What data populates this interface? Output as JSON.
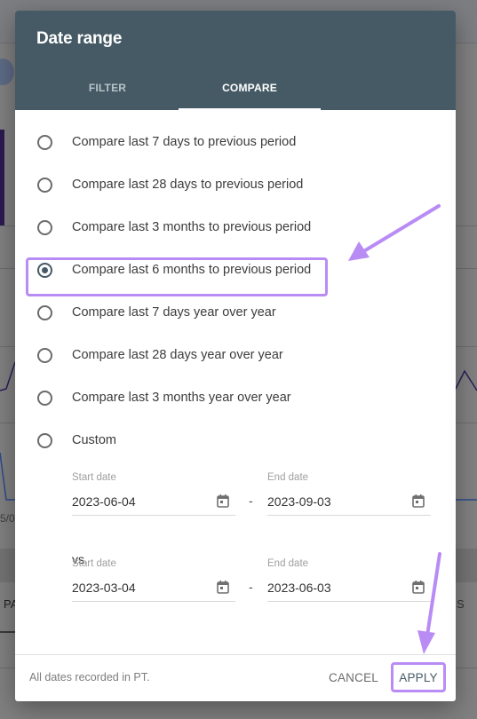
{
  "dialog": {
    "title": "Date range",
    "tabs": [
      {
        "label": "FILTER",
        "active": false
      },
      {
        "label": "COMPARE",
        "active": true
      }
    ],
    "options": [
      {
        "label": "Compare last 7 days to previous period",
        "checked": false
      },
      {
        "label": "Compare last 28 days to previous period",
        "checked": false
      },
      {
        "label": "Compare last 3 months to previous period",
        "checked": false
      },
      {
        "label": "Compare last 6 months to previous period",
        "checked": true
      },
      {
        "label": "Compare last 7 days year over year",
        "checked": false
      },
      {
        "label": "Compare last 28 days year over year",
        "checked": false
      },
      {
        "label": "Compare last 3 months year over year",
        "checked": false
      },
      {
        "label": "Custom",
        "checked": false
      }
    ],
    "custom": {
      "range1": {
        "start_label": "Start date",
        "start_value": "2023-06-04",
        "end_label": "End date",
        "end_value": "2023-09-03",
        "separator": "-"
      },
      "vs_label": "vs.",
      "range2": {
        "start_label": "Start date",
        "start_value": "2023-03-04",
        "end_label": "End date",
        "end_value": "2023-06-03",
        "separator": "-"
      }
    },
    "footer": {
      "note": "All dates recorded in PT.",
      "cancel_label": "CANCEL",
      "apply_label": "APPLY"
    }
  },
  "background": {
    "axis_fragment": "5/0",
    "left_fragment": "PA",
    "right_fragment": "S"
  },
  "colors": {
    "header": "#465a65",
    "annotation": "#b98cf5",
    "radio_checked": "#465a65"
  }
}
